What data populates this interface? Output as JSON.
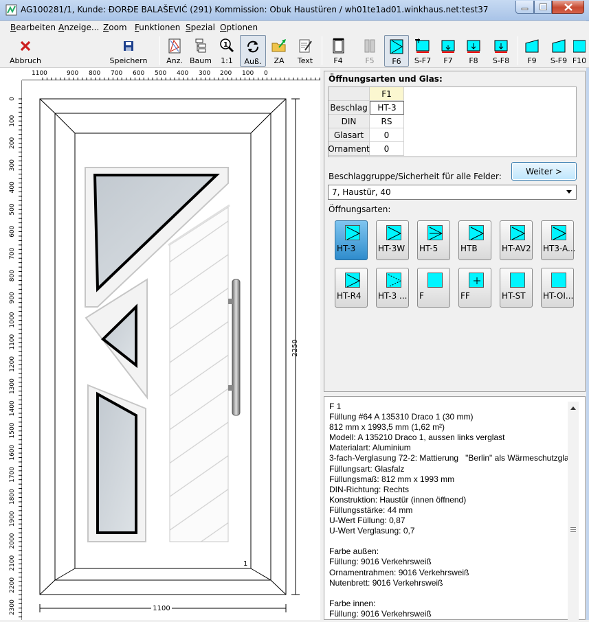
{
  "window": {
    "title": "AG100281/1, Kunde:  ĐORĐE BALAŠEVIĆ (291) Kommission: Obuk Haustüren / wh01te1ad01.winkhaus.net:test37"
  },
  "menu": [
    "Bearbeiten",
    "Anzeige...",
    "Zoom",
    "Funktionen",
    "Spezial",
    "Optionen"
  ],
  "toolbar": {
    "abbruch": "Abbruch",
    "speichern": "Speichern",
    "anz": "Anz.",
    "baum": "Baum",
    "one_to_one": "1:1",
    "aus": "Auß.",
    "za": "ZA",
    "text": "Text",
    "f4": "F4",
    "f5": "F5",
    "f6": "F6",
    "sf7": "S-F7",
    "f7": "F7",
    "f8": "F8",
    "sf8": "S-F8",
    "f9": "F9",
    "sf9": "S-F9",
    "f10": "F10"
  },
  "rulers": {
    "top": [
      "1100",
      "900",
      "800",
      "700",
      "600",
      "500",
      "400",
      "300",
      "200",
      "100",
      "0"
    ],
    "left": [
      "0",
      "100",
      "200",
      "300",
      "400",
      "500",
      "600",
      "700",
      "800",
      "900",
      "1000",
      "1100",
      "1200",
      "1300",
      "1400",
      "1500",
      "1600",
      "1700",
      "1800",
      "1900",
      "2000",
      "2100",
      "2200",
      "2300"
    ]
  },
  "drawing": {
    "width_dim": "1100",
    "height_dim": "2250",
    "field_no": "1"
  },
  "panel": {
    "header": "Öffnungsarten und Glas:",
    "grid": {
      "col": "F1",
      "rows": [
        {
          "label": "Beschlag",
          "value": "HT-3"
        },
        {
          "label": "DIN",
          "value": "RS"
        },
        {
          "label": "Glasart",
          "value": "0"
        },
        {
          "label": "Ornament",
          "value": "0"
        }
      ]
    },
    "weiter": "Weiter >",
    "beschlag_label": "Beschlaggruppe/Sicherheit für alle Felder:",
    "beschlag_value": "7, Haustür, 40",
    "oa_label": "Öffnungsarten:",
    "tiles": [
      "HT-3",
      "HT-3W",
      "HT-5",
      "HTB",
      "HT-AV2",
      "HT3-A...",
      "HT-R4",
      "HT-3 ...",
      "F",
      "FF",
      "HT-ST",
      "HT-OI..."
    ]
  },
  "info": {
    "text": "F 1\nFüllung #64 A 135310 Draco 1 (30 mm)\n812 mm x 1993,5 mm (1,62 m²)\nModell: A 135210 Draco 1, aussen links verglast\nMaterialart: Aluminium\n3-fach-Verglasung 72-2: Mattierung   \"Berlin\" als Wärmeschutzgla\nFüllungsart: Glasfalz\nFüllungsmaß: 812 mm x 1993 mm\nDIN-Richtung: Rechts\nKonstruktion: Haustür (innen öffnend)\nFüllungsstärke: 44 mm\nU-Wert Füllung: 0,87\nU-Wert Verglasung: 0,7\n\nFarbe außen:\nFüllung: 9016 Verkehrsweiß\nOrnamentrahmen: 9016 Verkehrsweiß\nNutenbrett: 9016 Verkehrsweiß\n\nFarbe innen:\nFüllung: 9016 Verkehrsweiß"
  },
  "colors": {
    "accent": "#00f5ff",
    "tile_active": "#2f8ccc",
    "abbruch_red": "#cc1e1e"
  }
}
